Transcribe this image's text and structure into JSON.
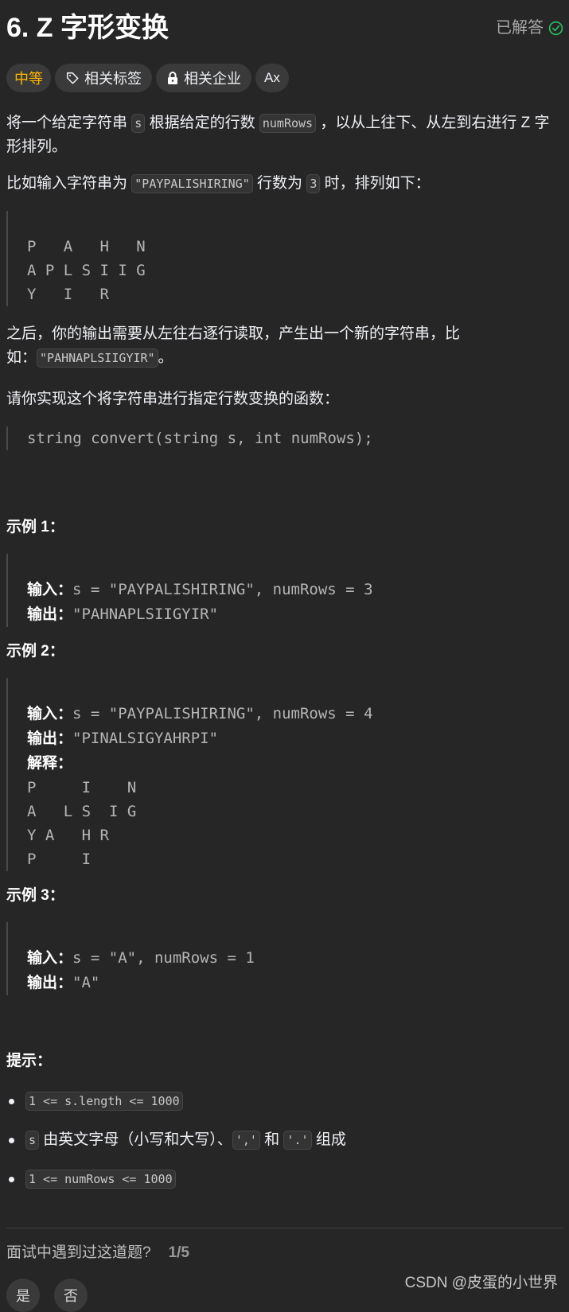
{
  "header": {
    "title": "6. Z 字形变换",
    "status_label": "已解答",
    "status_icon": "check-circle-icon",
    "status_color": "#2cbb5d"
  },
  "tags": {
    "difficulty": "中等",
    "difficulty_color": "#ffb800",
    "topics": "相关标签",
    "topics_icon": "tag-icon",
    "companies": "相关企业",
    "companies_icon": "lock-icon",
    "translate": "Ax",
    "translate_icon": "translate-icon"
  },
  "description": {
    "p1_a": "将一个给定字符串 ",
    "p1_code1": "s",
    "p1_b": " 根据给定的行数 ",
    "p1_code2": "numRows",
    "p1_c": " ，以从上往下、从左到右进行 Z 字形排列。",
    "p2_a": "比如输入字符串为 ",
    "p2_code1": "\"PAYPALISHIRING\"",
    "p2_b": " 行数为 ",
    "p2_code2": "3",
    "p2_c": " 时，排列如下：",
    "zigzag": [
      "P   A   H   N",
      "A P L S I I G",
      "Y   I   R"
    ],
    "p3_a": "之后，你的输出需要从左往右逐行读取，产生出一个新的字符串，比如：",
    "p3_code": "\"PAHNAPLSIIGYIR\"",
    "p3_b": "。",
    "p4": "请你实现这个将字符串进行指定行数变换的函数：",
    "signature": "string convert(string s, int numRows);"
  },
  "examples": [
    {
      "title": "示例 1：",
      "input_label": "输入：",
      "input": "s = \"PAYPALISHIRING\", numRows = 3",
      "output_label": "输出：",
      "output": "\"PAHNAPLSIIGYIR\""
    },
    {
      "title": "示例 2：",
      "input_label": "输入：",
      "input": "s = \"PAYPALISHIRING\", numRows = 4",
      "output_label": "输出：",
      "output": "\"PINALSIGYAHRPI\"",
      "explain_label": "解释：",
      "explain": [
        "P     I    N",
        "A   L S  I G",
        "Y A   H R",
        "P     I"
      ]
    },
    {
      "title": "示例 3：",
      "input_label": "输入：",
      "input": "s = \"A\", numRows = 1",
      "output_label": "输出：",
      "output": "\"A\""
    }
  ],
  "hints": {
    "title": "提示：",
    "h1_code": "1 <= s.length <= 1000",
    "h2_code1": "s",
    "h2_a": " 由英文字母（小写和大写）、",
    "h2_code2": "','",
    "h2_b": " 和 ",
    "h2_code3": "'.'",
    "h2_c": " 组成",
    "h3_code": "1 <= numRows <= 1000"
  },
  "footer": {
    "question": "面试中遇到过这道题?",
    "count": "1/5",
    "yes": "是",
    "no": "否",
    "watermark": "CSDN @皮蛋的小世界"
  }
}
